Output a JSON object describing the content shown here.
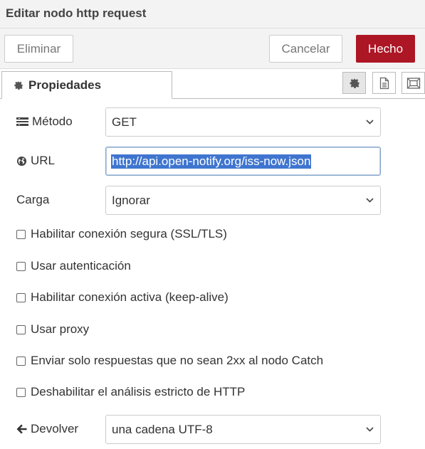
{
  "header": {
    "title": "Editar nodo http request"
  },
  "toolbar": {
    "delete_label": "Eliminar",
    "cancel_label": "Cancelar",
    "done_label": "Hecho"
  },
  "tabs": {
    "properties_label": "Propiedades"
  },
  "icons": {
    "properties_tab": "gear-icon",
    "settings_button": "gear-icon",
    "description_button": "document-icon",
    "appearance_button": "window-icon",
    "method": "list-icon",
    "url": "globe-icon",
    "return": "arrow-left-icon",
    "select_chevron": "chevron-down-icon"
  },
  "form": {
    "method": {
      "label": "Método",
      "value": "GET"
    },
    "url": {
      "label": "URL",
      "value": "http://api.open-notify.org/iss-now.json"
    },
    "payload": {
      "label": "Carga",
      "value": "Ignorar"
    },
    "checkboxes": [
      {
        "label": "Habilitar conexión segura (SSL/TLS)",
        "checked": false
      },
      {
        "label": "Usar autenticación",
        "checked": false
      },
      {
        "label": "Habilitar conexión activa (keep-alive)",
        "checked": false
      },
      {
        "label": "Usar proxy",
        "checked": false
      },
      {
        "label": "Enviar solo respuestas que no sean 2xx al nodo Catch",
        "checked": false
      },
      {
        "label": "Deshabilitar el análisis estricto de HTTP",
        "checked": false
      }
    ],
    "return": {
      "label": "Devolver",
      "value": "una cadena UTF-8"
    }
  },
  "colors": {
    "primary_button": "#ad1625",
    "selection": "#3f75cf"
  }
}
